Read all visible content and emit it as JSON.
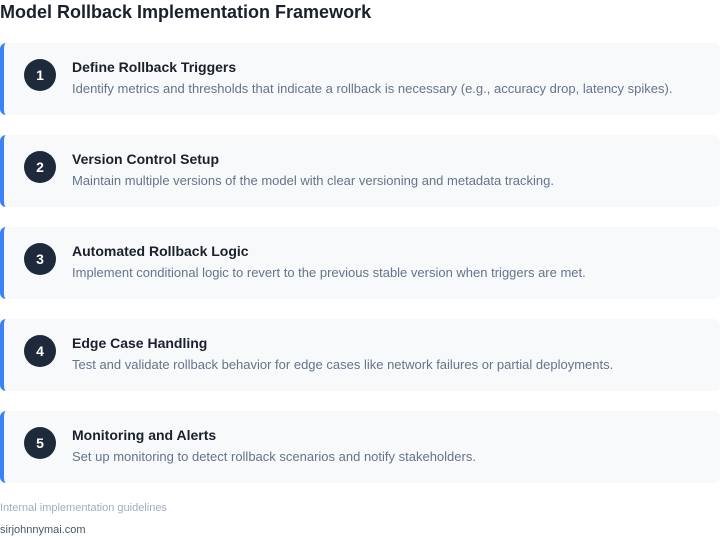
{
  "header": {
    "title": "Model Rollback Implementation Framework"
  },
  "steps": [
    {
      "number": "1",
      "title": "Define Rollback Triggers",
      "description": "Identify metrics and thresholds that indicate a rollback is necessary (e.g., accuracy drop, latency spikes)."
    },
    {
      "number": "2",
      "title": "Version Control Setup",
      "description": "Maintain multiple versions of the model with clear versioning and metadata tracking."
    },
    {
      "number": "3",
      "title": "Automated Rollback Logic",
      "description": "Implement conditional logic to revert to the previous stable version when triggers are met."
    },
    {
      "number": "4",
      "title": "Edge Case Handling",
      "description": "Test and validate rollback behavior for edge cases like network failures or partial deployments."
    },
    {
      "number": "5",
      "title": "Monitoring and Alerts",
      "description": "Set up monitoring to detect rollback scenarios and notify stakeholders."
    }
  ],
  "footer": {
    "note": "Internal implementation guidelines",
    "site": "sirjohnnymai.com"
  },
  "colors": {
    "accent": "#3b82f6",
    "badge": "#1e293b",
    "card_background": "#f7f9fb"
  }
}
